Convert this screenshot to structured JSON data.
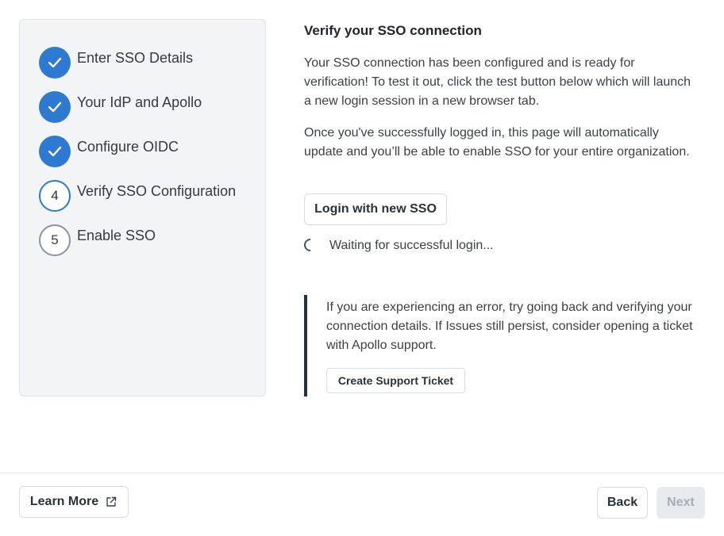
{
  "sidebar": {
    "steps": [
      {
        "number": "1",
        "label": "Enter SSO Details",
        "status": "completed",
        "icon": "checkmark-icon"
      },
      {
        "number": "2",
        "label": "Your IdP and Apollo",
        "status": "completed",
        "icon": "checkmark-icon"
      },
      {
        "number": "3",
        "label": "Configure OIDC",
        "status": "completed",
        "icon": "checkmark-icon"
      },
      {
        "number": "4",
        "label": "Verify SSO Configuration",
        "status": "current"
      },
      {
        "number": "5",
        "label": "Enable SSO",
        "status": "pending"
      }
    ]
  },
  "main": {
    "title": "Verify your SSO connection",
    "paragraph1": "Your SSO connection has been configured and is ready for verification! To test it out, click the test button below which will launch a new login session in a new browser tab.",
    "paragraph2": "Once you've successfully logged in, this page will automatically update and you’ll be able to enable SSO for your entire organization.",
    "login_button": "Login with new SSO",
    "waiting_text": "Waiting for successful login...",
    "callout": {
      "text": "If you are experiencing an error, try going back and verifying your connection details. If Issues still persist, consider opening a ticket with Apollo support.",
      "button": "Create Support Ticket"
    }
  },
  "footer": {
    "learn_more": "Learn More",
    "learn_more_icon": "external-link-icon",
    "back": "Back",
    "next": "Next",
    "next_disabled": true
  },
  "colors": {
    "accent": "#2f7ad1",
    "panel_bg": "#f2f4f6",
    "callout_bar": "#22323f",
    "disabled_bg": "#e8ebee"
  }
}
